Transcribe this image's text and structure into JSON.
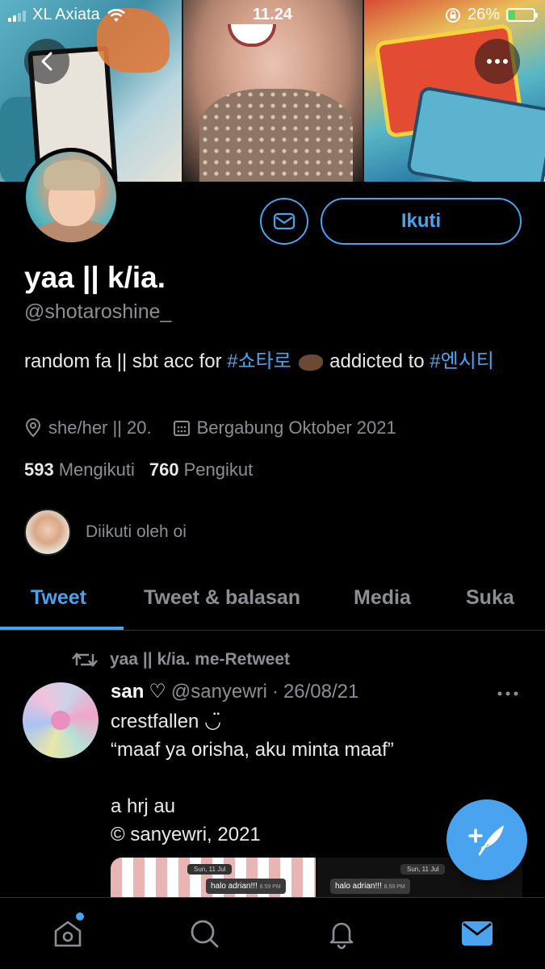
{
  "status_bar": {
    "carrier": "XL Axiata",
    "time": "11.24",
    "battery": "26%",
    "battery_level": 0.26,
    "icons": [
      "signal-bars-icon",
      "wifi-icon",
      "rotation-lock-icon",
      "battery-icon"
    ]
  },
  "profile": {
    "name": "yaa || k/ia.",
    "handle": "@shotaroshine_",
    "bio_text_1": "random fa || sbt acc for ",
    "bio_tag_1": "#쇼타로",
    "bio_text_2": " addicted to ",
    "bio_tag_2": "#엔시티",
    "location": "she/her || 20.",
    "joined": "Bergabung Oktober 2021",
    "following_count": "593",
    "following_label": "Mengikuti",
    "followers_count": "760",
    "followers_label": "Pengikut",
    "followed_by": "Diikuti oleh oi",
    "follow_label": "Ikuti"
  },
  "tabs": [
    {
      "label": "Tweet",
      "active": true
    },
    {
      "label": "Tweet & balasan",
      "active": false
    },
    {
      "label": "Media",
      "active": false
    },
    {
      "label": "Suka",
      "active": false
    }
  ],
  "tweet": {
    "retweet_line": "yaa || k/ia. me-Retweet",
    "author": "san",
    "author_symbol": "♡",
    "handle": "@sanyewri",
    "separator": "·",
    "date": "26/08/21",
    "text": "crestfallen ◡̈\n“maaf ya orisha, aku minta maaf”\n\na hrj au\n© sanyewri, 2021",
    "thumb_1": {
      "date_chip": "Sun, 11 Jul",
      "bubble": "halo adrian!!!",
      "time": "8.59 PM"
    },
    "thumb_2": {
      "date_chip": "Sun, 11 Jul",
      "bubble": "halo adrian!!!",
      "time": "8.59 PM"
    }
  },
  "colors": {
    "accent": "#4aa3ef",
    "background": "#000000",
    "secondary_text": "#8b8f94"
  }
}
